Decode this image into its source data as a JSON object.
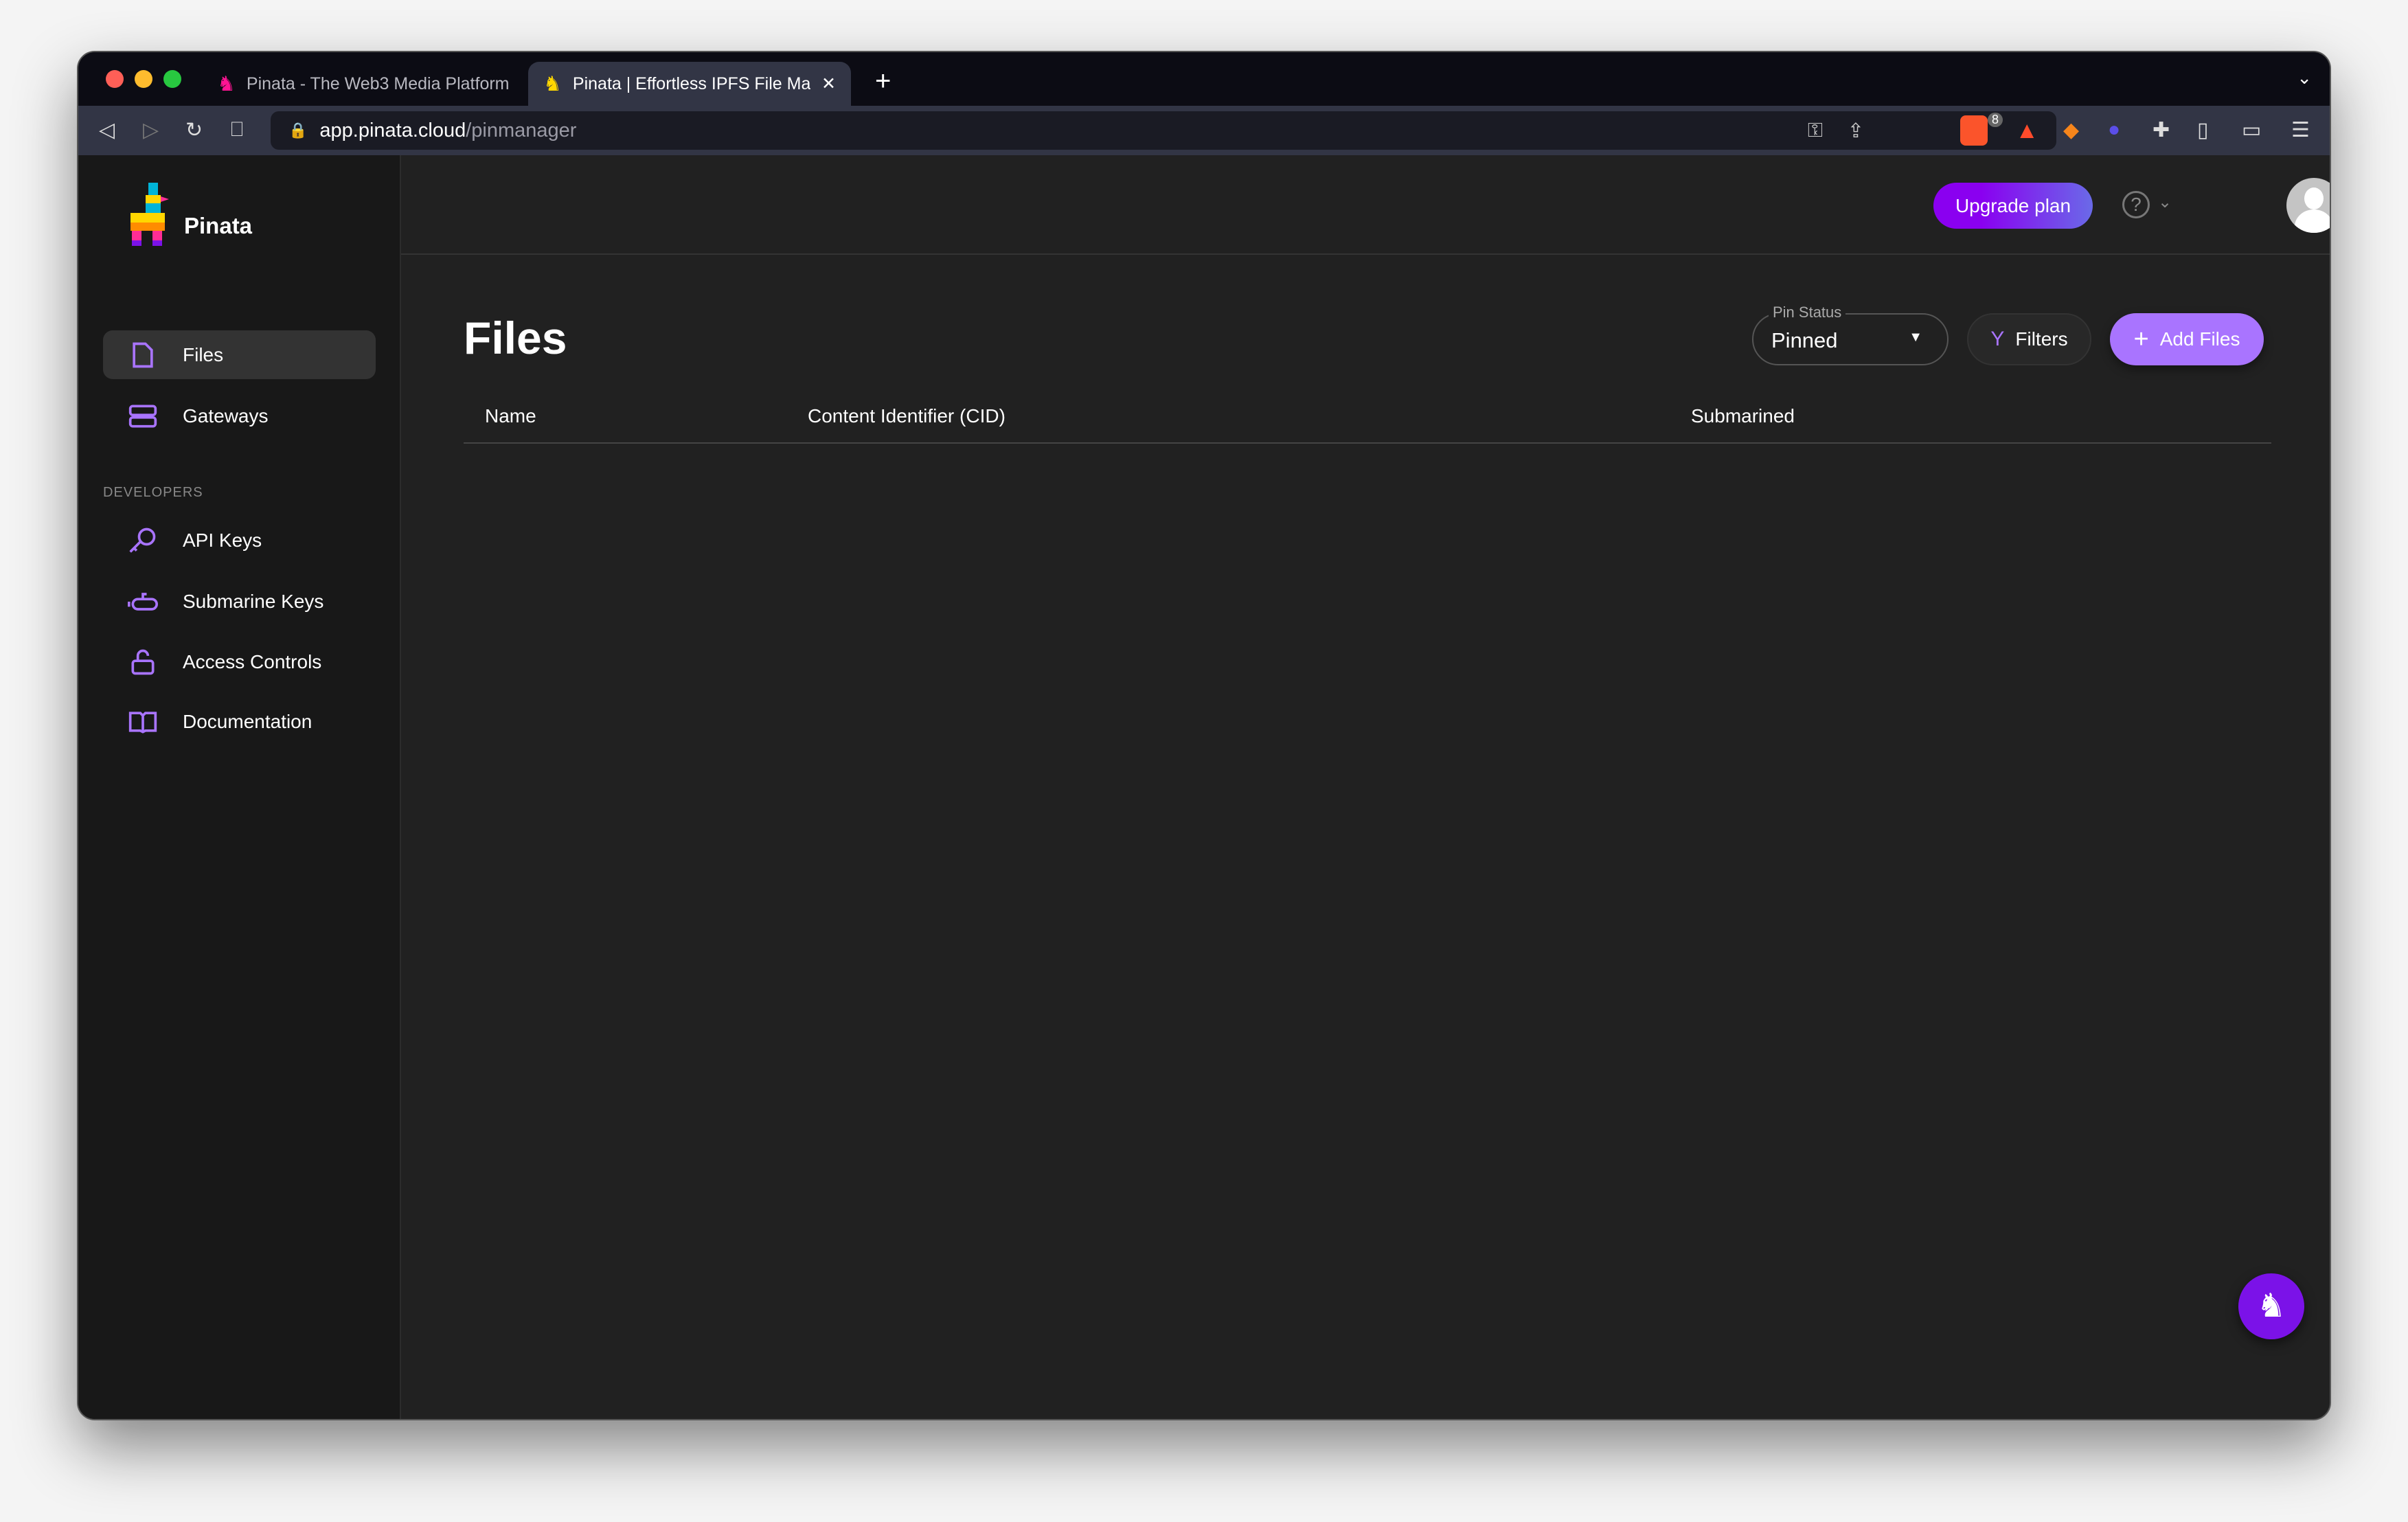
{
  "browser": {
    "tabs": [
      {
        "title": "Pinata - The Web3 Media Platform",
        "active": false
      },
      {
        "title": "Pinata | Effortless IPFS File Man",
        "active": true
      }
    ],
    "url_host": "app.pinata.cloud",
    "url_path": "/pinmanager",
    "brave_badge": "8"
  },
  "sidebar": {
    "brand": "Pinata",
    "items": [
      {
        "label": "Files",
        "icon": "file-icon",
        "active": true
      },
      {
        "label": "Gateways",
        "icon": "server-icon"
      }
    ],
    "section": "DEVELOPERS",
    "dev_items": [
      {
        "label": "API Keys",
        "icon": "key-icon"
      },
      {
        "label": "Submarine Keys",
        "icon": "submarine-icon"
      },
      {
        "label": "Access Controls",
        "icon": "unlock-icon"
      },
      {
        "label": "Documentation",
        "icon": "book-icon"
      }
    ]
  },
  "header": {
    "upgrade": "Upgrade plan"
  },
  "main": {
    "title": "Files",
    "pin_status_label": "Pin Status",
    "pin_status_value": "Pinned",
    "filters": "Filters",
    "add_files": "Add Files",
    "columns": [
      "Name",
      "Content Identifier (CID)",
      "Submarined"
    ]
  },
  "colors": {
    "accent": "#a974ff",
    "upgrade_gradient": [
      "#8a00f0",
      "#6a6ae8"
    ],
    "fab": "#7b12e8"
  }
}
